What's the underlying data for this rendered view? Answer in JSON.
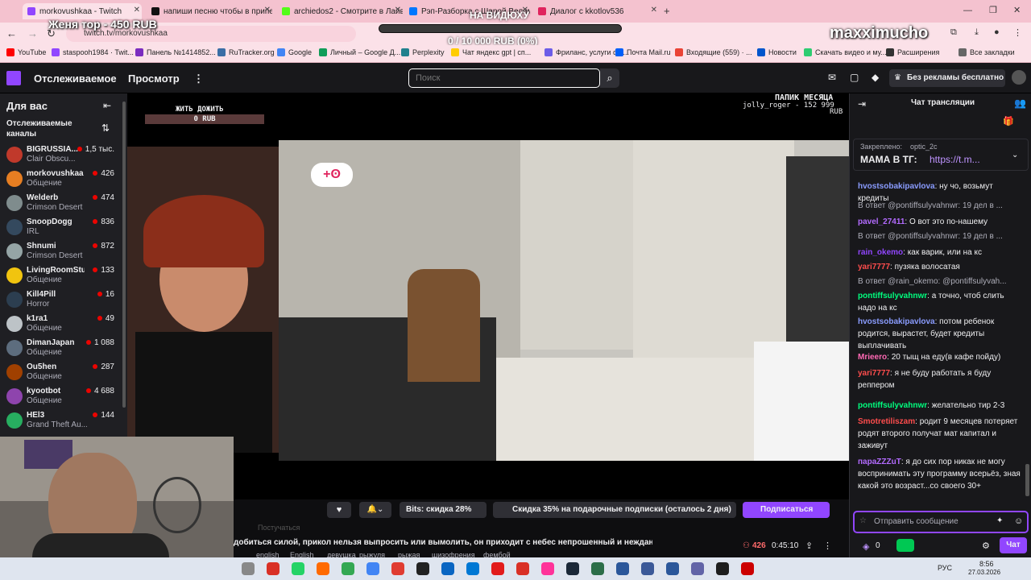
{
  "tabs": [
    {
      "title": "morkovushkaa - Twitch",
      "color": "#9146ff",
      "active": true
    },
    {
      "title": "напиши песню чтобы в припе",
      "color": "#111111"
    },
    {
      "title": "archiedos2 - Смотрите в Лайв",
      "color": "#53fc18"
    },
    {
      "title": "Рэп-Разборка с Шарой Велими",
      "color": "#0077ff"
    },
    {
      "title": "Диалог с kkotlov536",
      "color": "#e0245e"
    }
  ],
  "tab_add": "+",
  "address": "twitch.tv/morkovushkaa",
  "overlay": {
    "donation_top": "Женя тор - 450 RUB",
    "goal_title": "НА ВИДЮХУ",
    "goal_progress": "0 / 10 000 RUB (0%)",
    "goal_fraction": 0,
    "streamer_handle": "maxximucho"
  },
  "bookmarks": [
    {
      "label": "YouTube",
      "color": "#ff0000"
    },
    {
      "label": "staspooh1984 · Twit...",
      "color": "#9146ff"
    },
    {
      "label": "Панель №1414852...",
      "color": "#7b2cbf"
    },
    {
      "label": "RuTracker.org",
      "color": "#3a6ea5"
    },
    {
      "label": "Google",
      "color": "#4285f4"
    },
    {
      "label": "Личный – Google Д...",
      "color": "#0f9d58"
    },
    {
      "label": "Perplexity",
      "color": "#20808d"
    },
    {
      "label": "Чат яндекс gpt | сп...",
      "color": "#ffcc00"
    },
    {
      "label": "Фриланс, услуги фр...",
      "color": "#6c5ce7"
    },
    {
      "label": "Почта Mail.ru",
      "color": "#005ff9"
    },
    {
      "label": "Входящие (559) · ...",
      "color": "#ea4335"
    },
    {
      "label": "Новости",
      "color": "#0055cc"
    },
    {
      "label": "Скачать видео и му...",
      "color": "#2ecc71"
    },
    {
      "label": "Расширения",
      "color": "#333333"
    },
    {
      "label": "Все закладки",
      "color": "#666666"
    }
  ],
  "nav": {
    "following": "Отслеживаемое",
    "browse": "Просмотр",
    "search_placeholder": "Поиск",
    "prime": "Без рекламы бесплатно"
  },
  "sidebar": {
    "title": "Для вас",
    "section": "Отслеживаемые каналы",
    "channels": [
      {
        "name": "BIGRUSSIA...",
        "game": "Clair Obscu...",
        "viewers": "1,5 тыс.",
        "color": "#c0392b"
      },
      {
        "name": "morkovushkaa",
        "game": "Общение",
        "viewers": "426",
        "color": "#e67e22"
      },
      {
        "name": "Welderb",
        "game": "Crimson Desert",
        "viewers": "474",
        "color": "#7f8c8d"
      },
      {
        "name": "SnoopDogg",
        "game": "IRL",
        "viewers": "836",
        "color": "#34495e"
      },
      {
        "name": "Shnumi",
        "game": "Crimson Desert",
        "viewers": "872",
        "color": "#95a5a6"
      },
      {
        "name": "LivingRoomStu...",
        "game": "Общение",
        "viewers": "133",
        "color": "#f1c40f"
      },
      {
        "name": "Kill4Pill",
        "game": "Horror",
        "viewers": "16",
        "color": "#2c3e50"
      },
      {
        "name": "k1ra1",
        "game": "Общение",
        "viewers": "49",
        "color": "#bdc3c7"
      },
      {
        "name": "DimanJapan",
        "game": "Общение",
        "viewers": "1 088",
        "color": "#5d6d7e"
      },
      {
        "name": "Ou5hen",
        "game": "Общение",
        "viewers": "287",
        "color": "#a04000"
      },
      {
        "name": "kyootbot",
        "game": "Общение",
        "viewers": "4 688",
        "color": "#8e44ad"
      },
      {
        "name": "HEl3",
        "game": "Grand Theft Au...",
        "viewers": "144",
        "color": "#27ae60"
      }
    ]
  },
  "video_overlay": {
    "left_label": "ЖИТЬ ДОЖИТЬ",
    "left_value": "0 RUB",
    "right_title": "ПАПИК МЕСЯЦА",
    "right_value": "jolly_roger - 152 999",
    "right_unit": "RUB"
  },
  "chat": {
    "title": "Чат трансляции",
    "pinned_label": "Закреплено:",
    "pinned_user": "optic_2c",
    "pinned_text": "МАМА В ТГ:",
    "pinned_link": "https://t.m...",
    "input_placeholder": "Отправить сообщение",
    "points": "0",
    "send": "Чат",
    "messages": [
      {
        "type": "msg",
        "user": "hvostsobakipavlova",
        "color": "#8a9cff",
        "text": "ну чо, возьмут кредиты"
      },
      {
        "type": "reply",
        "text": "В ответ @pontiffsulyvahnwr: 19 дел в ..."
      },
      {
        "type": "msg",
        "user": "pavel_27411",
        "color": "#b36bff",
        "text": "О вот это по-нашему"
      },
      {
        "type": "reply",
        "text": "В ответ @pontiffsulyvahnwr: 19 дел в ..."
      },
      {
        "type": "msg",
        "user": "rain_okemo",
        "color": "#9146ff",
        "text": "как варик, или на кс"
      },
      {
        "type": "msg",
        "user": "yari7777",
        "color": "#ff4d4d",
        "text": "пузяка волосатая"
      },
      {
        "type": "reply",
        "text": "В ответ @rain_okemo: @pontiffsulyvah..."
      },
      {
        "type": "msg",
        "user": "pontiffsulyvahnwr",
        "color": "#00ff7f",
        "text": "а точно, чтоб слить надо на кс"
      },
      {
        "type": "msg",
        "user": "hvostsobakipavlova",
        "color": "#8a9cff",
        "text": "потом ребенок родится, вырастет, будет кредиты выплачивать"
      },
      {
        "type": "msg",
        "user": "Mrieero",
        "color": "#ff69b4",
        "text": "20 тыщ на еду(в кафе пойду)"
      },
      {
        "type": "msg",
        "user": "yari7777",
        "color": "#ff4d4d",
        "text": "я не буду работать я буду реппером"
      },
      {
        "type": "msg",
        "user": "pontiffsulyvahnwr",
        "color": "#00ff7f",
        "text": "желательно тир 2-3"
      },
      {
        "type": "msg",
        "user": "Smotretiliszam",
        "color": "#ff4d4d",
        "text": "родит 9 месяцев потеряет родят второго получат мат капитал и заживут"
      },
      {
        "type": "msg",
        "user": "пapaZZZuT",
        "color": "#b36bff",
        "text": "я до сих пор никак не могу воспринимать эту программу всерьёз, зная какой это возраст...со своего 30+"
      }
    ]
  },
  "info": {
    "bits": "Bits: скидка 28%",
    "gift": "Скидка 35% на подарочные подписки (осталось 2 дня)",
    "subscribe": "Подписаться",
    "following_label": "Постучаться",
    "title": "добиться силой, прикол нельзя выпросить или вымолить, он приходит с небес непрошенный и нежданный",
    "viewers": "426",
    "uptime": "0:45:10",
    "tags": [
      "english",
      "English",
      "девушка",
      "рыжуля",
      "рыжая",
      "шизофрения",
      "фембой"
    ]
  },
  "taskbar": {
    "lang": "РУС",
    "time": "8:56",
    "date": "27.03.2026"
  }
}
